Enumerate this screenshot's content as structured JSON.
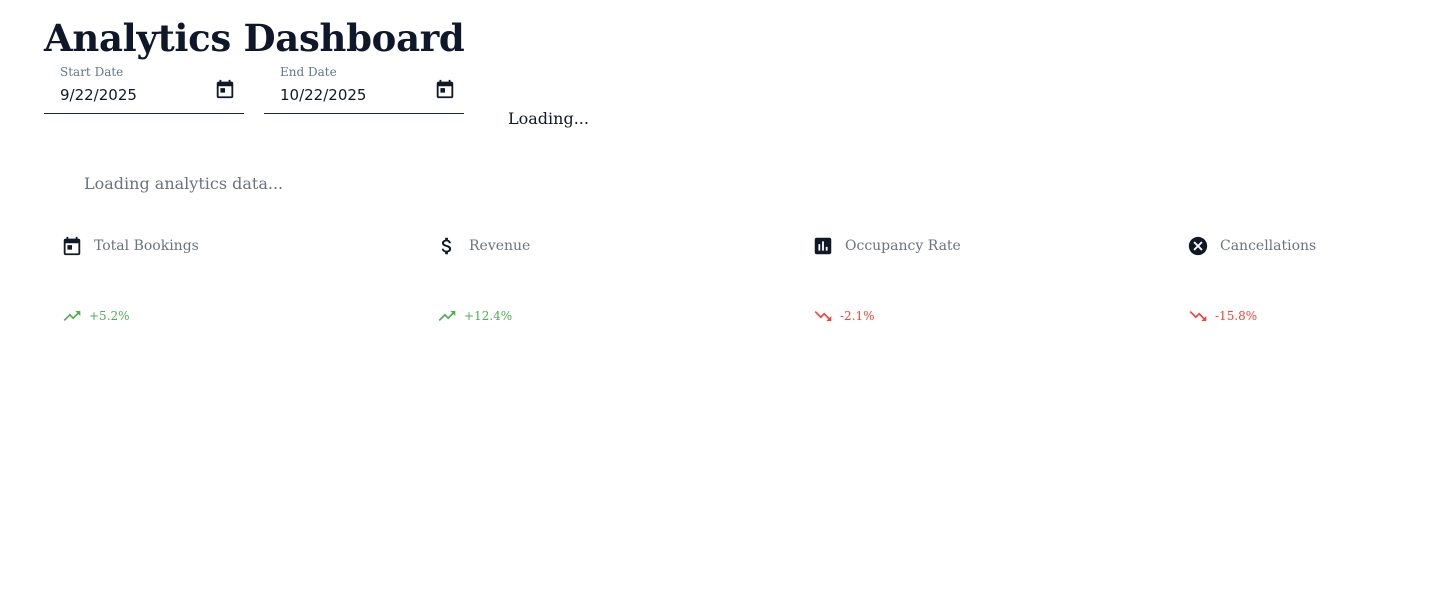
{
  "header": {
    "title": "Analytics Dashboard"
  },
  "filters": {
    "start_date": {
      "label": "Start Date",
      "value": "9/22/2025"
    },
    "end_date": {
      "label": "End Date",
      "value": "10/22/2025"
    },
    "status": "Loading..."
  },
  "main": {
    "loading_message": "Loading analytics data..."
  },
  "metrics": [
    {
      "label": "Total Bookings",
      "icon": "calendar-icon",
      "change": "+5.2%",
      "trend": "up",
      "trend_color": "#4caf50"
    },
    {
      "label": "Revenue",
      "icon": "dollar-icon",
      "change": "+12.4%",
      "trend": "up",
      "trend_color": "#4caf50"
    },
    {
      "label": "Occupancy Rate",
      "icon": "bar-chart-icon",
      "change": "-2.1%",
      "trend": "down",
      "trend_color": "#f44336"
    },
    {
      "label": "Cancellations",
      "icon": "cancel-circle-icon",
      "change": "-15.8%",
      "trend": "down",
      "trend_color": "#f44336"
    }
  ],
  "colors": {
    "text_primary": "#0f172a",
    "text_muted": "#6b7280",
    "trend_up": "#4caf50",
    "trend_down": "#f44336"
  }
}
